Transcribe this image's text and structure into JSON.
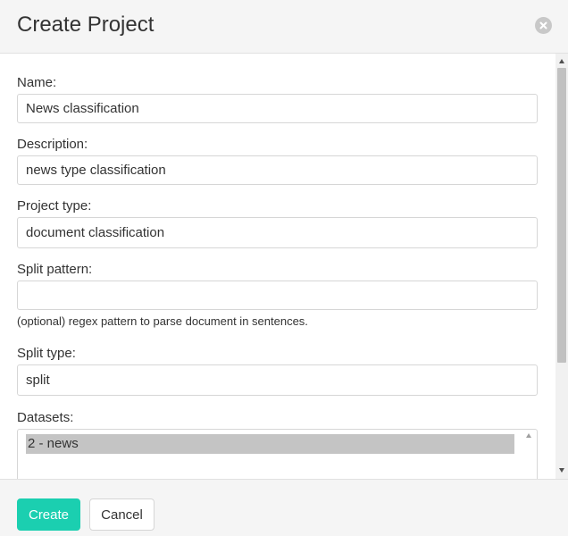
{
  "dialog": {
    "title": "Create Project",
    "close_icon": "close-circle-icon"
  },
  "form": {
    "name": {
      "label": "Name:",
      "value": "News classification"
    },
    "description": {
      "label": "Description:",
      "value": "news type classification"
    },
    "project_type": {
      "label": "Project type:",
      "value": "document classification"
    },
    "split_pattern": {
      "label": "Split pattern:",
      "value": "",
      "help": "(optional) regex pattern to parse document in sentences."
    },
    "split_type": {
      "label": "Split type:",
      "value": "split"
    },
    "datasets": {
      "label": "Datasets:",
      "options": [
        "2 - news"
      ],
      "selected": "2 - news"
    }
  },
  "footer": {
    "create_label": "Create",
    "cancel_label": "Cancel"
  },
  "colors": {
    "primary": "#1bcfb0",
    "header_bg": "#f5f5f5",
    "selected_option_bg": "#c4c4c4"
  }
}
